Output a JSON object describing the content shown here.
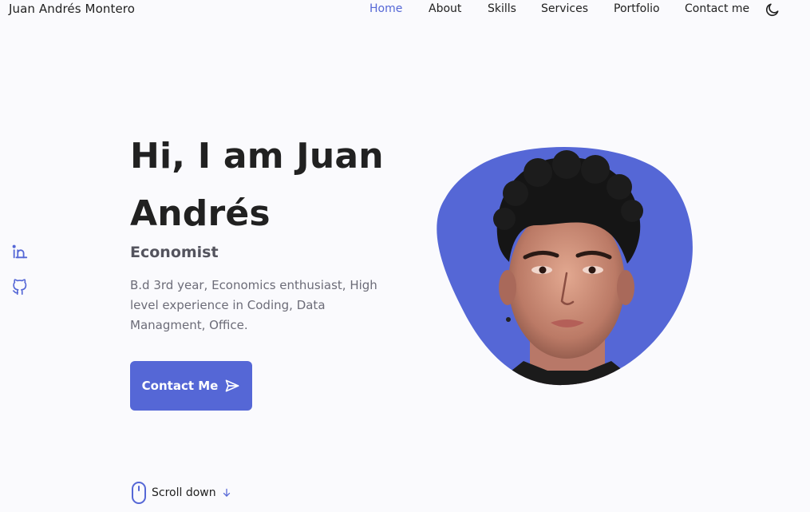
{
  "header": {
    "logo": "Juan Andrés Montero",
    "nav": [
      {
        "label": "Home",
        "active": true
      },
      {
        "label": "About",
        "active": false
      },
      {
        "label": "Skills",
        "active": false
      },
      {
        "label": "Services",
        "active": false
      },
      {
        "label": "Portfolio",
        "active": false
      },
      {
        "label": "Contact me",
        "active": false
      }
    ],
    "theme_icon": "moon-icon"
  },
  "social": [
    "linkedin-icon",
    "github-icon"
  ],
  "hero": {
    "title": "Hi, I am Juan Andrés",
    "subtitle": "Economist",
    "description": "B.d 3rd year, Economics enthusiast, High level experience in Coding, Data Managment, Office.",
    "button_label": "Contact Me",
    "button_icon": "send-icon",
    "image": "profile-photo"
  },
  "scroll": {
    "label": "Scroll down",
    "icon": "mouse-icon",
    "arrow": "arrow-down-icon"
  },
  "colors": {
    "accent": "#5567d6",
    "background": "#fafafd",
    "text": "#212121",
    "muted": "#6c6c78"
  }
}
